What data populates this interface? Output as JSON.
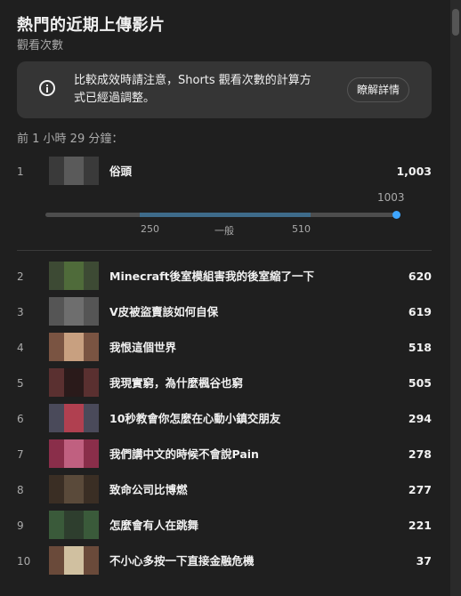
{
  "header": {
    "title": "熱門的近期上傳影片",
    "subtitle": "觀看次數"
  },
  "notice": {
    "icon": "info-icon",
    "text": "比較成效時請注意，Shorts 觀看次數的計算方式已經過調整。",
    "button_label": "瞭解詳情"
  },
  "timespan": "前 1 小時 29 分鐘：",
  "top_video": {
    "rank": "1",
    "title": "俗頭",
    "views": "1,003",
    "thumb_color": "#8a8a8a",
    "range": {
      "current_label": "1003",
      "low_label": "250",
      "typical_label": "一般",
      "high_label": "510",
      "low": 250,
      "high": 510,
      "current": 1003
    }
  },
  "videos": [
    {
      "rank": "2",
      "title": "Minecraft後室模組害我的後室縮了一下",
      "views": "620",
      "thumb_color": "#4f6b3a"
    },
    {
      "rank": "3",
      "title": "V皮被盜賣該如何自保",
      "views": "619",
      "thumb_color": "#6e6e6e"
    },
    {
      "rank": "4",
      "title": "我恨這個世界",
      "views": "518",
      "thumb_color": "#9a6a52"
    },
    {
      "rank": "5",
      "title": "我現實窮，為什麼楓谷也窮",
      "views": "505",
      "thumb_color": "#6b3a3a"
    },
    {
      "rank": "6",
      "title": "10秒教會你怎麼在心動小鎮交朋友",
      "views": "294",
      "thumb_color": "#5a5a6e"
    },
    {
      "rank": "7",
      "title": "我們講中文的時候不會說Pain",
      "views": "278",
      "thumb_color": "#8a2e4a"
    },
    {
      "rank": "8",
      "title": "致命公司比博燃",
      "views": "277",
      "thumb_color": "#4a3a2e"
    },
    {
      "rank": "9",
      "title": "怎麼會有人在跳舞",
      "views": "221",
      "thumb_color": "#3a5a3a"
    },
    {
      "rank": "10",
      "title": "不小心多按一下直接金融危機",
      "views": "37",
      "thumb_color": "#7a5a4a"
    }
  ]
}
